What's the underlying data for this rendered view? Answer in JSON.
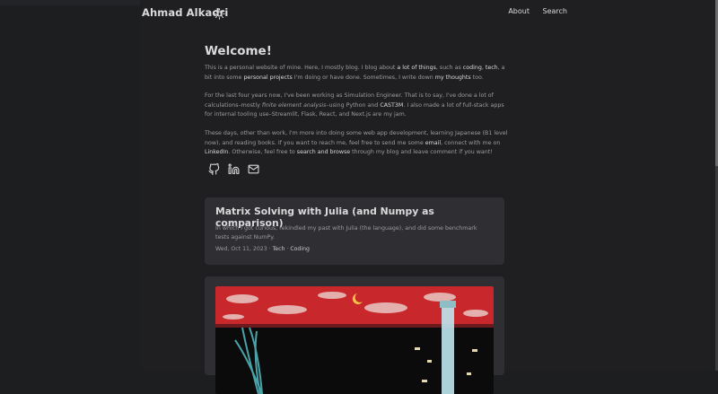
{
  "site": {
    "title": "Ahmad Alkadri",
    "nav": [
      "About",
      "Search"
    ]
  },
  "intro": {
    "heading": "Welcome!",
    "p1": {
      "a": "This is a personal website of mine. Here, I mostly blog. I blog about ",
      "link1": "a lot of things",
      "b": ", such as ",
      "link2": "coding",
      "c": ", ",
      "link3": "tech",
      "d": ", a bit into some ",
      "link4": "personal projects",
      "e": " I'm doing or have done. Sometimes, I write down ",
      "link5": "my thoughts",
      "f": " too."
    },
    "p2": {
      "a": "For the last four years now, I've been working as Simulation Engineer. That is to say, I've done a lot of calculations–mostly ",
      "em": "finite element analysis",
      "b": "–using Python and ",
      "link1": "CAST3M",
      "c": ". I also made a lot of full-stack apps for internal tooling use–Streamlit, Flask, React, and Next.js are my jam."
    },
    "p3": {
      "a": "These days, other than work, I'm more into doing some web app development, learning Japanese (B1 level now), and reading books. If you want to reach me, feel free to send me some ",
      "link1": "email",
      "b": ", connect with me on ",
      "link2": "LinkedIn",
      "c": ". Otherwise, feel free to ",
      "link3": "search and browse",
      "d": " through my blog and leave comment if you want!"
    }
  },
  "social_icons": [
    "github-icon",
    "linkedin-icon",
    "email-icon"
  ],
  "posts": [
    {
      "title": "Matrix Solving with Julia (and Numpy as comparison)",
      "summary": "In which I got curious, rekindled my past with Julia (the language), and did some benchmark tests against NumPy.",
      "date": "Wed, Oct 11, 2023",
      "sep": "·",
      "tags": [
        "Tech",
        "Coding"
      ]
    }
  ],
  "colors": {
    "background": "#1d1e20",
    "card": "#2e2e33",
    "primary_text": "#dadadb",
    "secondary_text": "#9b9c9d",
    "cover_red": "#c8272c"
  }
}
